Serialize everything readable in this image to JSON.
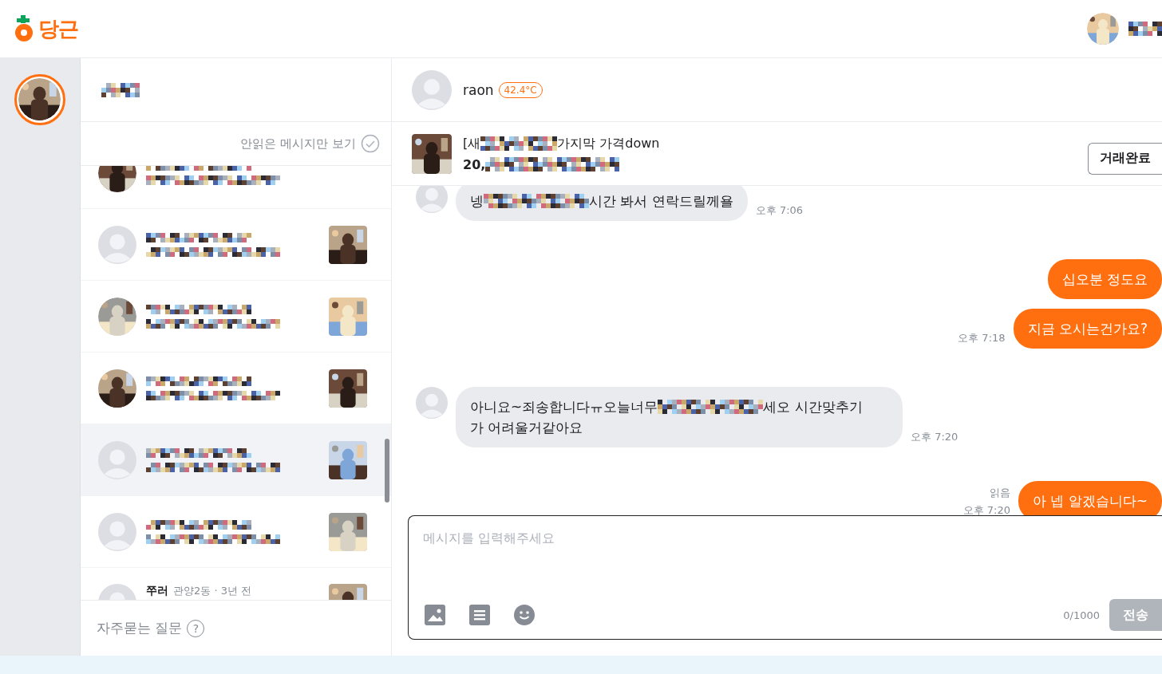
{
  "header": {
    "logo": "당근"
  },
  "filter": {
    "label": "안읽은 메시지만 보기",
    "checked": false
  },
  "chats": [
    {
      "photo": true,
      "thumbnail": false,
      "selected": false
    },
    {
      "photo": false,
      "thumbnail": true,
      "selected": false
    },
    {
      "photo": true,
      "thumbnail": true,
      "selected": false
    },
    {
      "photo": true,
      "thumbnail": true,
      "selected": false
    },
    {
      "photo": false,
      "thumbnail": true,
      "selected": true
    },
    {
      "photo": false,
      "thumbnail": true,
      "selected": false
    },
    {
      "photo": false,
      "thumbnail": true,
      "selected": false,
      "name": "쭈러",
      "meta": "관양2동 · 3년 전"
    }
  ],
  "faq": {
    "label": "자주묻는 질문",
    "icon": "?"
  },
  "partner": {
    "name": "raon",
    "temperature": "42.4°C"
  },
  "product": {
    "title": [
      {
        "kind": "text",
        "text": "[새"
      },
      {
        "kind": "redacted"
      },
      {
        "kind": "text",
        "text": "가지막 가격down"
      }
    ],
    "price": [
      {
        "kind": "text",
        "text": "20,"
      },
      {
        "kind": "redacted"
      }
    ],
    "button": "거래완료"
  },
  "messages": [
    {
      "outgoing": false,
      "parts": [
        {
          "kind": "text",
          "text": "넹"
        },
        {
          "kind": "redacted"
        },
        {
          "kind": "text",
          "text": "시간 봐서 연락드릴께욜"
        }
      ],
      "time": "오후 7:06"
    },
    {
      "outgoing": true,
      "parts": [
        {
          "kind": "text",
          "text": "십오분 정도요"
        }
      ]
    },
    {
      "outgoing": true,
      "parts": [
        {
          "kind": "text",
          "text": "지금 오시는건가요?"
        }
      ],
      "time": "오후 7:18"
    },
    {
      "outgoing": false,
      "parts": [
        {
          "kind": "text",
          "text": "아니요~죄송합니다ㅠ오늘너무"
        },
        {
          "kind": "redacted"
        },
        {
          "kind": "text",
          "text": "세오 시간맞추기"
        },
        {
          "kind": "text",
          "text": "가 어려울거같아요"
        }
      ],
      "time": "오후 7:20"
    },
    {
      "outgoing": true,
      "parts": [
        {
          "kind": "text",
          "text": "아 넵 알겠습니다~"
        }
      ],
      "read": "읽음",
      "time": "오후 7:20"
    }
  ],
  "composer": {
    "placeholder": "메시지를 입력해주세요",
    "counter": "0/1000",
    "send": "전송",
    "send_disabled": true
  }
}
